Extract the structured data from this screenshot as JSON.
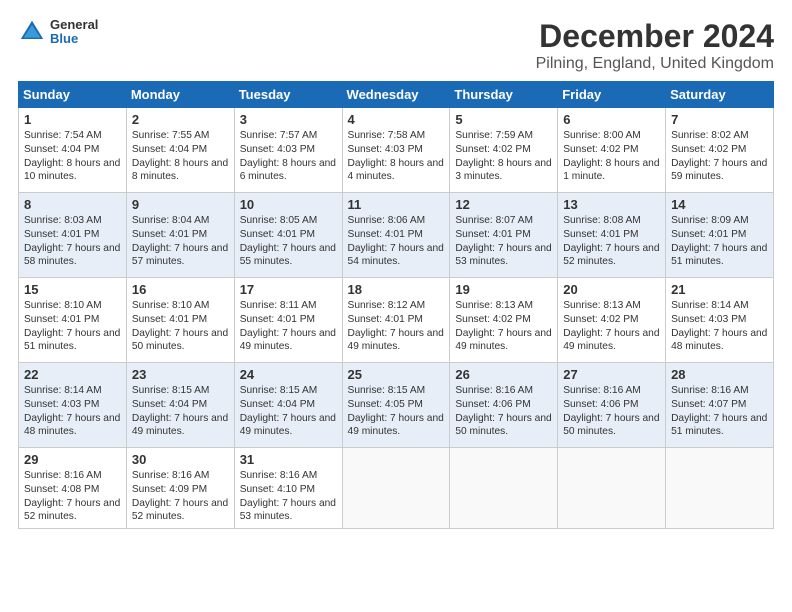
{
  "header": {
    "logo_line1": "General",
    "logo_line2": "Blue",
    "title": "December 2024",
    "subtitle": "Pilning, England, United Kingdom"
  },
  "columns": [
    "Sunday",
    "Monday",
    "Tuesday",
    "Wednesday",
    "Thursday",
    "Friday",
    "Saturday"
  ],
  "weeks": [
    [
      {
        "day": "1",
        "rise": "Sunrise: 7:54 AM",
        "set": "Sunset: 4:04 PM",
        "daylight": "Daylight: 8 hours and 10 minutes."
      },
      {
        "day": "2",
        "rise": "Sunrise: 7:55 AM",
        "set": "Sunset: 4:04 PM",
        "daylight": "Daylight: 8 hours and 8 minutes."
      },
      {
        "day": "3",
        "rise": "Sunrise: 7:57 AM",
        "set": "Sunset: 4:03 PM",
        "daylight": "Daylight: 8 hours and 6 minutes."
      },
      {
        "day": "4",
        "rise": "Sunrise: 7:58 AM",
        "set": "Sunset: 4:03 PM",
        "daylight": "Daylight: 8 hours and 4 minutes."
      },
      {
        "day": "5",
        "rise": "Sunrise: 7:59 AM",
        "set": "Sunset: 4:02 PM",
        "daylight": "Daylight: 8 hours and 3 minutes."
      },
      {
        "day": "6",
        "rise": "Sunrise: 8:00 AM",
        "set": "Sunset: 4:02 PM",
        "daylight": "Daylight: 8 hours and 1 minute."
      },
      {
        "day": "7",
        "rise": "Sunrise: 8:02 AM",
        "set": "Sunset: 4:02 PM",
        "daylight": "Daylight: 7 hours and 59 minutes."
      }
    ],
    [
      {
        "day": "8",
        "rise": "Sunrise: 8:03 AM",
        "set": "Sunset: 4:01 PM",
        "daylight": "Daylight: 7 hours and 58 minutes."
      },
      {
        "day": "9",
        "rise": "Sunrise: 8:04 AM",
        "set": "Sunset: 4:01 PM",
        "daylight": "Daylight: 7 hours and 57 minutes."
      },
      {
        "day": "10",
        "rise": "Sunrise: 8:05 AM",
        "set": "Sunset: 4:01 PM",
        "daylight": "Daylight: 7 hours and 55 minutes."
      },
      {
        "day": "11",
        "rise": "Sunrise: 8:06 AM",
        "set": "Sunset: 4:01 PM",
        "daylight": "Daylight: 7 hours and 54 minutes."
      },
      {
        "day": "12",
        "rise": "Sunrise: 8:07 AM",
        "set": "Sunset: 4:01 PM",
        "daylight": "Daylight: 7 hours and 53 minutes."
      },
      {
        "day": "13",
        "rise": "Sunrise: 8:08 AM",
        "set": "Sunset: 4:01 PM",
        "daylight": "Daylight: 7 hours and 52 minutes."
      },
      {
        "day": "14",
        "rise": "Sunrise: 8:09 AM",
        "set": "Sunset: 4:01 PM",
        "daylight": "Daylight: 7 hours and 51 minutes."
      }
    ],
    [
      {
        "day": "15",
        "rise": "Sunrise: 8:10 AM",
        "set": "Sunset: 4:01 PM",
        "daylight": "Daylight: 7 hours and 51 minutes."
      },
      {
        "day": "16",
        "rise": "Sunrise: 8:10 AM",
        "set": "Sunset: 4:01 PM",
        "daylight": "Daylight: 7 hours and 50 minutes."
      },
      {
        "day": "17",
        "rise": "Sunrise: 8:11 AM",
        "set": "Sunset: 4:01 PM",
        "daylight": "Daylight: 7 hours and 49 minutes."
      },
      {
        "day": "18",
        "rise": "Sunrise: 8:12 AM",
        "set": "Sunset: 4:01 PM",
        "daylight": "Daylight: 7 hours and 49 minutes."
      },
      {
        "day": "19",
        "rise": "Sunrise: 8:13 AM",
        "set": "Sunset: 4:02 PM",
        "daylight": "Daylight: 7 hours and 49 minutes."
      },
      {
        "day": "20",
        "rise": "Sunrise: 8:13 AM",
        "set": "Sunset: 4:02 PM",
        "daylight": "Daylight: 7 hours and 49 minutes."
      },
      {
        "day": "21",
        "rise": "Sunrise: 8:14 AM",
        "set": "Sunset: 4:03 PM",
        "daylight": "Daylight: 7 hours and 48 minutes."
      }
    ],
    [
      {
        "day": "22",
        "rise": "Sunrise: 8:14 AM",
        "set": "Sunset: 4:03 PM",
        "daylight": "Daylight: 7 hours and 48 minutes."
      },
      {
        "day": "23",
        "rise": "Sunrise: 8:15 AM",
        "set": "Sunset: 4:04 PM",
        "daylight": "Daylight: 7 hours and 49 minutes."
      },
      {
        "day": "24",
        "rise": "Sunrise: 8:15 AM",
        "set": "Sunset: 4:04 PM",
        "daylight": "Daylight: 7 hours and 49 minutes."
      },
      {
        "day": "25",
        "rise": "Sunrise: 8:15 AM",
        "set": "Sunset: 4:05 PM",
        "daylight": "Daylight: 7 hours and 49 minutes."
      },
      {
        "day": "26",
        "rise": "Sunrise: 8:16 AM",
        "set": "Sunset: 4:06 PM",
        "daylight": "Daylight: 7 hours and 50 minutes."
      },
      {
        "day": "27",
        "rise": "Sunrise: 8:16 AM",
        "set": "Sunset: 4:06 PM",
        "daylight": "Daylight: 7 hours and 50 minutes."
      },
      {
        "day": "28",
        "rise": "Sunrise: 8:16 AM",
        "set": "Sunset: 4:07 PM",
        "daylight": "Daylight: 7 hours and 51 minutes."
      }
    ],
    [
      {
        "day": "29",
        "rise": "Sunrise: 8:16 AM",
        "set": "Sunset: 4:08 PM",
        "daylight": "Daylight: 7 hours and 52 minutes."
      },
      {
        "day": "30",
        "rise": "Sunrise: 8:16 AM",
        "set": "Sunset: 4:09 PM",
        "daylight": "Daylight: 7 hours and 52 minutes."
      },
      {
        "day": "31",
        "rise": "Sunrise: 8:16 AM",
        "set": "Sunset: 4:10 PM",
        "daylight": "Daylight: 7 hours and 53 minutes."
      },
      null,
      null,
      null,
      null
    ]
  ]
}
